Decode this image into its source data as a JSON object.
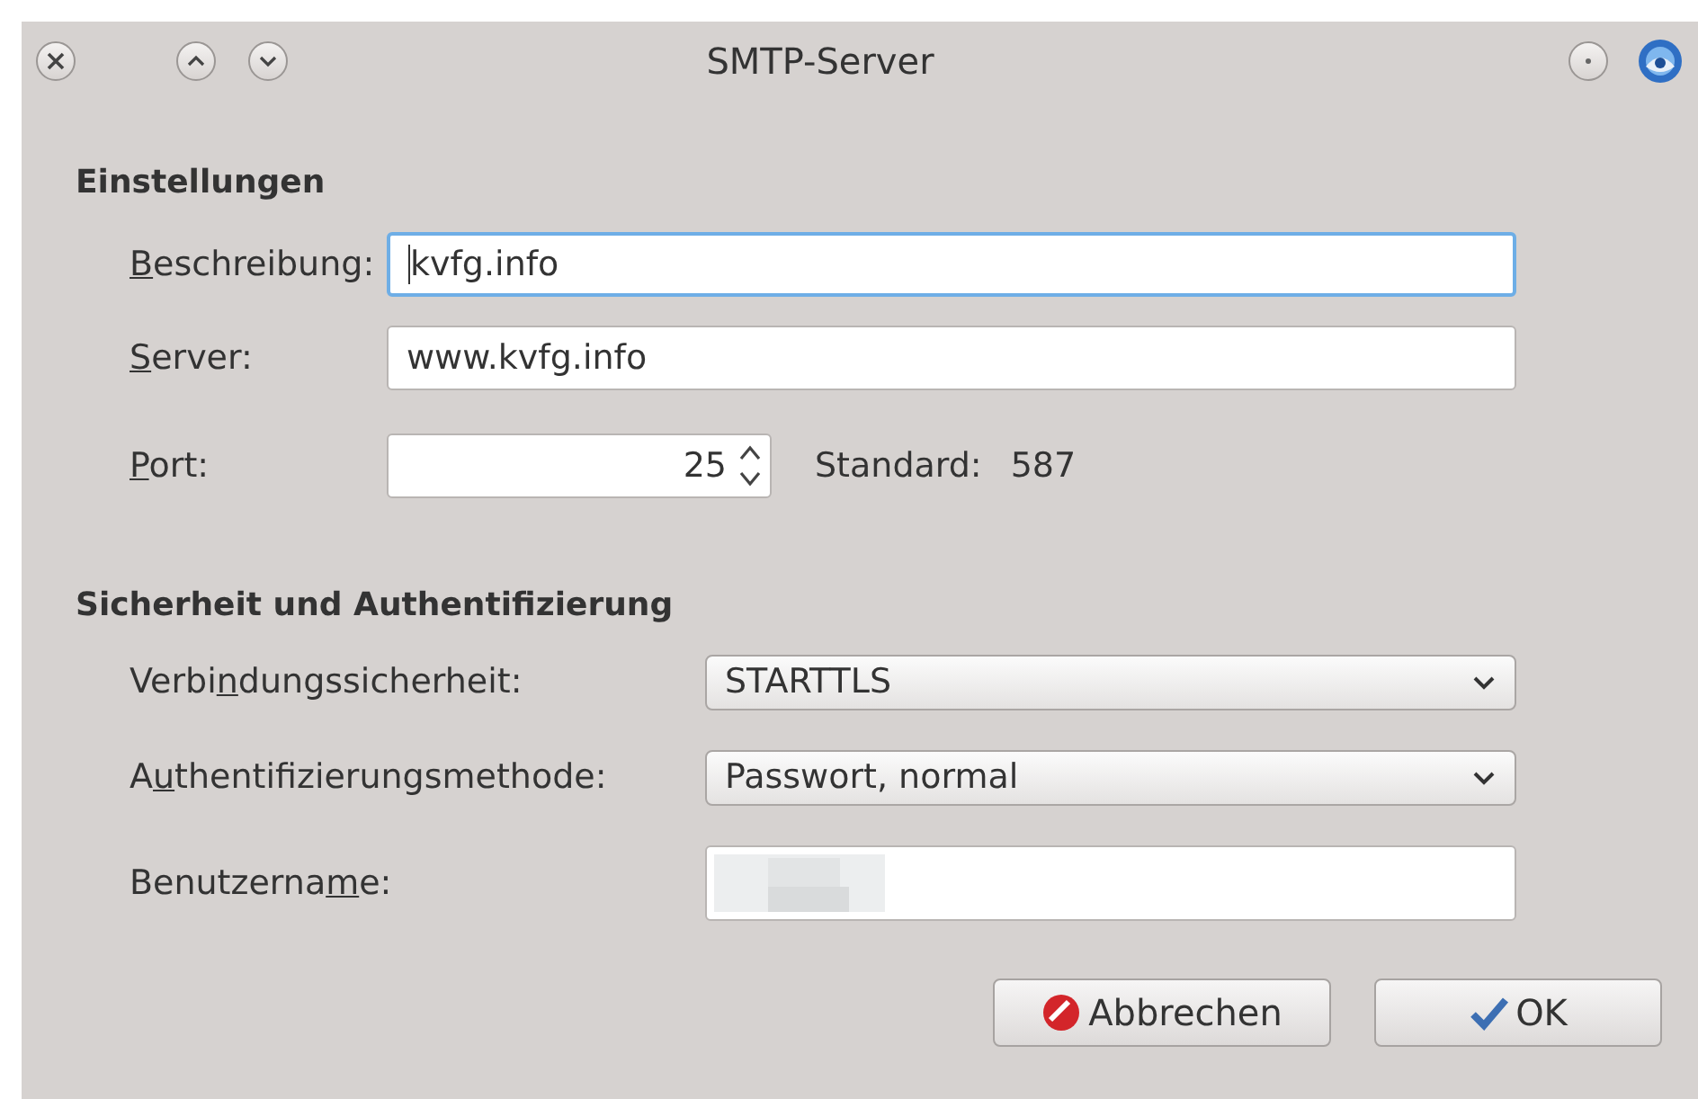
{
  "window": {
    "title": "SMTP-Server"
  },
  "sections": [
    {
      "heading": "Einstellungen",
      "rows": [
        {
          "kind": "text",
          "label": {
            "key": "B",
            "after": "eschreibung:"
          },
          "value": "kvfg.info",
          "focused": true
        },
        {
          "kind": "text",
          "label": {
            "key": "S",
            "after": "erver:"
          },
          "value": "www.kvfg.info",
          "focused": false
        },
        {
          "kind": "spin",
          "label": {
            "key": "P",
            "after": "ort:"
          },
          "value": "25",
          "note_label": "Standard:",
          "note_value": "587"
        }
      ]
    },
    {
      "heading": "Sicherheit und Authentifizierung",
      "rows": [
        {
          "kind": "select",
          "label": {
            "before": "Verbi",
            "key": "n",
            "after": "dungssicherheit:"
          },
          "value": "STARTTLS"
        },
        {
          "kind": "select",
          "label": {
            "before": "A",
            "key": "u",
            "after": "thentifizierungsmethode:"
          },
          "value": "Passwort, normal"
        },
        {
          "kind": "redacted",
          "label": {
            "before": "Benutzerna",
            "key": "m",
            "after": "e:"
          }
        }
      ]
    }
  ],
  "buttons": [
    {
      "kind": "cancel",
      "label": "Abbrechen"
    },
    {
      "kind": "ok",
      "label": "OK"
    }
  ]
}
